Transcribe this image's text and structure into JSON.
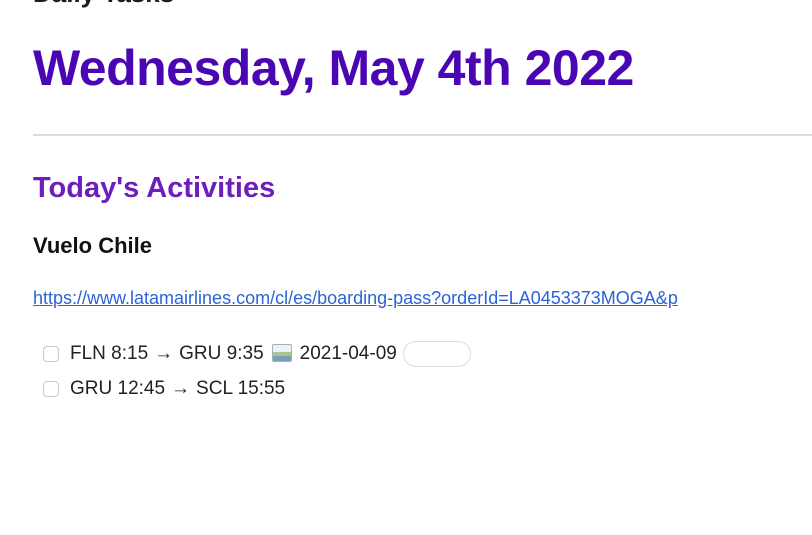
{
  "top_partial_text": "Daily Tasks",
  "page_title": "Wednesday, May 4th 2022",
  "section_heading": "Today's Activities",
  "sub_heading": "Vuelo Chile",
  "link": {
    "text": "https://www.latamairlines.com/cl/es/boarding-pass?orderId=LA0453373MOGA&p",
    "color": "#2c63d6"
  },
  "tasks": [
    {
      "from": "FLN 8:15",
      "arrow": "→",
      "to": "GRU 9:35",
      "icon": "calendar-icon",
      "date": "2021-04-09",
      "checked": false
    },
    {
      "from": "GRU 12:45",
      "arrow": "→",
      "to": "SCL 15:55",
      "checked": false
    }
  ],
  "colors": {
    "title": "#4a06b3",
    "section_heading": "#6d1ebc",
    "divider": "#dcdcdc"
  }
}
